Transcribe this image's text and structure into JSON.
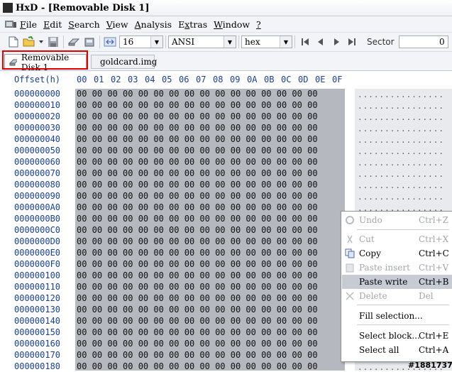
{
  "window": {
    "app_icon": "HxD",
    "title": "HxD - [Removable Disk 1]"
  },
  "menu": [
    {
      "label": "File",
      "ul": "F"
    },
    {
      "label": "Edit",
      "ul": "E"
    },
    {
      "label": "Search",
      "ul": "S"
    },
    {
      "label": "View",
      "ul": "V"
    },
    {
      "label": "Analysis",
      "ul": "A"
    },
    {
      "label": "Extras",
      "ul": "x"
    },
    {
      "label": "Window",
      "ul": "W"
    },
    {
      "label": "?",
      "ul": "?"
    }
  ],
  "toolbar": {
    "bytes_per_row": "16",
    "charset": "ANSI",
    "offset_base": "hex",
    "sector_label": "Sector",
    "sector_value": "0",
    "icons": [
      "new-file-icon",
      "open-folder-icon",
      "dropdown-arrow-icon",
      "save-icon",
      "disk-icon",
      "disk-image-icon",
      "bytes-per-row-icon",
      "first-icon",
      "previous-icon",
      "next-icon",
      "last-icon"
    ]
  },
  "tabs": [
    {
      "label": "Removable Disk 1",
      "icon": "disk-icon",
      "active": true
    },
    {
      "label": "goldcard.img",
      "icon": "disk-image-icon",
      "active": false
    }
  ],
  "editor": {
    "offset_header": "Offset(h)",
    "columns": [
      "00",
      "01",
      "02",
      "03",
      "04",
      "05",
      "06",
      "07",
      "08",
      "09",
      "0A",
      "0B",
      "0C",
      "0D",
      "0E",
      "0F"
    ],
    "offsets": [
      "000000000",
      "000000010",
      "000000020",
      "000000030",
      "000000040",
      "000000050",
      "000000060",
      "000000070",
      "000000080",
      "000000090",
      "0000000A0",
      "0000000B0",
      "0000000C0",
      "0000000D0",
      "0000000E0",
      "0000000F0",
      "000000100",
      "000000110",
      "000000120",
      "000000130",
      "000000140",
      "000000150",
      "000000160",
      "000000170",
      "000000180"
    ],
    "byte_value": "00",
    "text_row": "................"
  },
  "context_menu": [
    {
      "label": "Undo",
      "shortcut": "Ctrl+Z",
      "enabled": false,
      "icon": "undo-icon"
    },
    {
      "label": "Cut",
      "shortcut": "Ctrl+X",
      "enabled": false,
      "icon": "cut-icon"
    },
    {
      "label": "Copy",
      "shortcut": "Ctrl+C",
      "enabled": true,
      "icon": "copy-icon"
    },
    {
      "label": "Paste insert",
      "shortcut": "Ctrl+V",
      "enabled": false,
      "icon": "paste-icon"
    },
    {
      "label": "Paste write",
      "shortcut": "Ctrl+B",
      "enabled": true,
      "selected": true
    },
    {
      "label": "Delete",
      "shortcut": "Del",
      "enabled": false,
      "icon": "delete-icon"
    },
    {
      "label": "Fill selection...",
      "shortcut": "",
      "enabled": true
    },
    {
      "label": "Select block...",
      "shortcut": "Ctrl+E",
      "enabled": true
    },
    {
      "label": "Select all",
      "shortcut": "Ctrl+A",
      "enabled": true
    }
  ],
  "watermark": "#1881737",
  "colors": {
    "selection_bg": "#b5b8bf",
    "offset_color": "#1a3e9a",
    "highlight_border": "#e30000"
  }
}
